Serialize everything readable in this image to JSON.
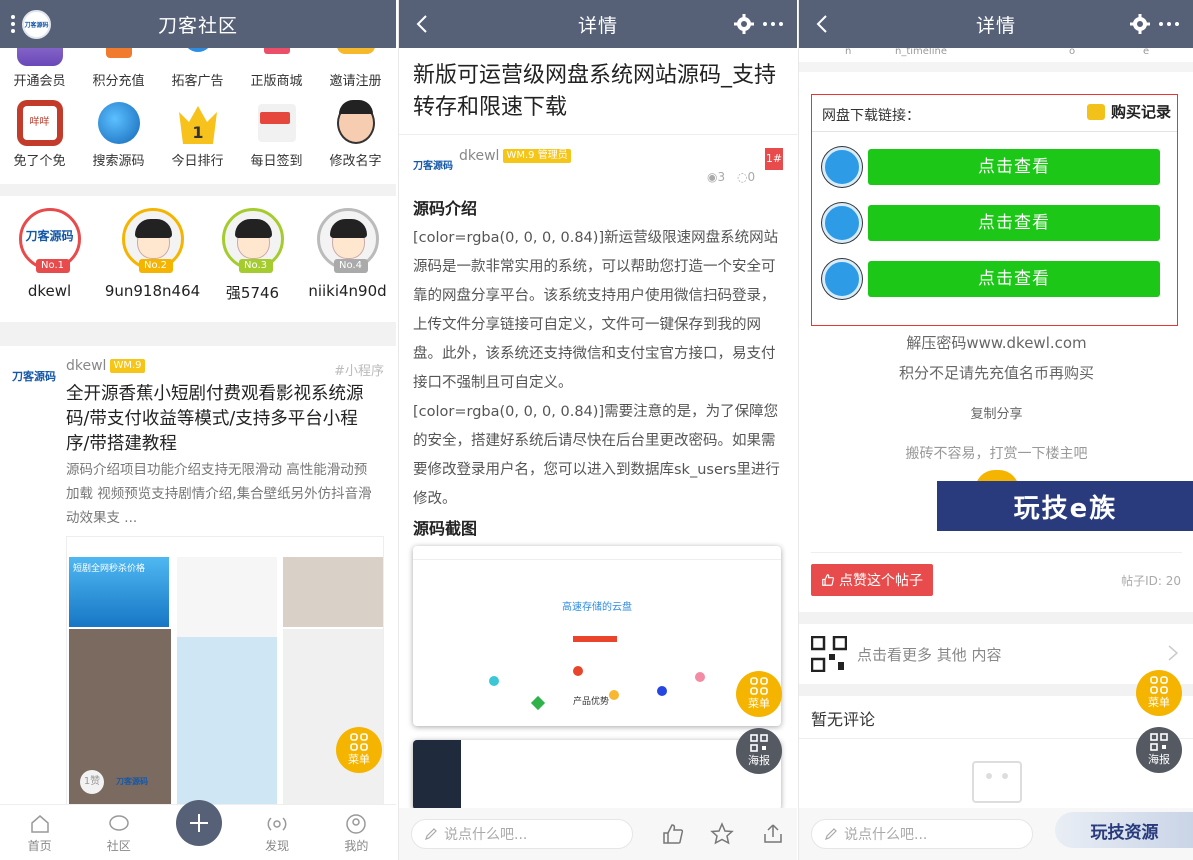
{
  "panel1": {
    "title": "刀客社区",
    "logo_text": "刀客源码",
    "icons_row1": [
      "开通会员",
      "积分充值",
      "拓客广告",
      "正版商城",
      "邀请注册"
    ],
    "icons_row2": [
      "免了个免",
      "搜索源码",
      "今日排行",
      "每日签到",
      "修改名字"
    ],
    "ranking": [
      {
        "name": "dkewl",
        "badge": "No.1"
      },
      {
        "name": "9un918n464",
        "badge": "No.2"
      },
      {
        "name": "强5746",
        "badge": "No.3"
      },
      {
        "name": "niiki4n90d",
        "badge": "No.4"
      }
    ],
    "post": {
      "author": "dkewl",
      "level": "WM.9",
      "tag": "#小程序",
      "title": "全开源香蕉小短剧付费观看影视系统源码/带支付收益等模式/支持多平台小程序/带搭建教程",
      "summary": "源码介绍项目功能介绍支持无限滑动 高性能滑动预加载 视频预览支持剧情介绍,集合壁纸另外仿抖音滑动效果支 ...",
      "thumb_banner": "短剧全网秒杀价格",
      "likes": "1赞",
      "avatar_text": "刀客源码"
    },
    "fab_menu": "菜单",
    "tabs": [
      "首页",
      "社区",
      "",
      "发现",
      "我的"
    ]
  },
  "panel2": {
    "title": "详情",
    "article_title": "新版可运营级网盘系统网站源码_支持转存和限速下载",
    "author": "dkewl",
    "author_role": "WM.9 管理员",
    "floor": "1#",
    "views": "3",
    "comments": "0",
    "section1": "源码介绍",
    "para1": "[color=rgba(0, 0, 0, 0.84)]新运营级限速网盘系统网站源码是一款非常实用的系统，可以帮助您打造一个安全可靠的网盘分享平台。该系统支持用户使用微信扫码登录，上传文件分享链接可自定义，文件可一键保存到我的网盘。此外，该系统还支持微信和支付宝官方接口，易支付接口不强制且可自定义。",
    "para2": "[color=rgba(0, 0, 0, 0.84)]需要注意的是，为了保障您的安全，搭建好系统后请尽快在后台里更改密码。如果需要修改登录用户名，您可以进入到数据库sk_users里进行修改。",
    "section2": "源码截图",
    "shot_title": "高速存储的云盘",
    "shot_sub": "产品优势",
    "fab_menu": "菜单",
    "fab_poster": "海报",
    "say_placeholder": "说点什么吧..."
  },
  "panel3": {
    "title": "详情",
    "top_labels": [
      "n",
      "n_timeline",
      "o",
      "e"
    ],
    "dl_label": "网盘下载链接：",
    "buy_record": "购买记录",
    "view_buttons": [
      "点击查看",
      "点击查看",
      "点击查看"
    ],
    "unzip": "解压密码www.dkewl.com",
    "insufficient": "积分不足请先充值名币再购买",
    "copy_share": "复制分享",
    "reward": "搬砖不容易，打赏一下楼主吧",
    "banner": "玩技e族",
    "like_btn": "点赞这个帖子",
    "post_id": "帖子ID: 20",
    "more": "点击看更多 其他 内容",
    "no_comment": "暂无评论",
    "fab_menu": "菜单",
    "fab_poster": "海报",
    "say_placeholder": "说点什么吧...",
    "watermark": "玩技资源"
  },
  "colors": {
    "header": "#566178",
    "accent_green": "#1dc717",
    "accent_red": "#e74b4b",
    "fab_yellow": "#f5b400"
  }
}
